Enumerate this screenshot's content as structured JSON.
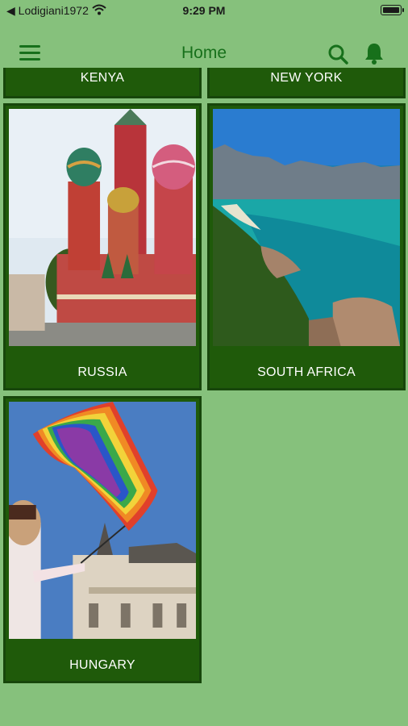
{
  "status_bar": {
    "carrier": "◀ Lodigiani1972",
    "time": "9:29 PM"
  },
  "navbar": {
    "title": "Home",
    "icons": [
      "menu-icon",
      "search-icon",
      "bell-icon"
    ]
  },
  "cards": [
    {
      "label": "KENYA",
      "image": null
    },
    {
      "label": "NEW YORK",
      "image": null
    },
    {
      "label": "RUSSIA",
      "image": "st-basils-cathedral"
    },
    {
      "label": "SOUTH AFRICA",
      "image": "coastal-cliffs"
    },
    {
      "label": "HUNGARY",
      "image": "rainbow-flag-parliament"
    }
  ],
  "colors": {
    "background": "#86c17c",
    "accent": "#17701b",
    "card": "#1f5a0a"
  }
}
